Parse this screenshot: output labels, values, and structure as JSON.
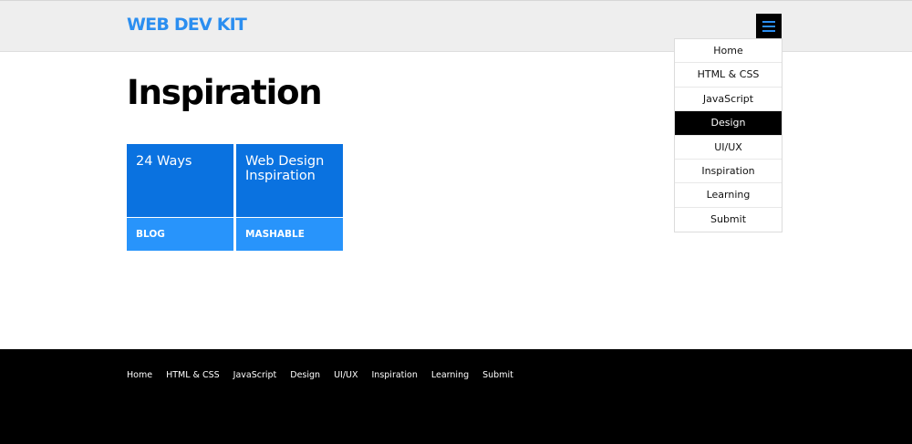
{
  "header": {
    "logo": "WEB DEV KIT",
    "menu_icon": "hamburger-menu-icon",
    "accent_color": "#2b8ef0"
  },
  "dropdown": {
    "items": [
      "Home",
      "HTML & CSS",
      "JavaScript",
      "Design",
      "UI/UX",
      "Inspiration",
      "Learning",
      "Submit"
    ],
    "active": "Design"
  },
  "main": {
    "title": "Inspiration",
    "cards": [
      {
        "name": "24 Ways",
        "source": "BLOG"
      },
      {
        "name": "Web Design Inspiration",
        "source": "MASHABLE"
      }
    ]
  },
  "footer": {
    "links": [
      "Home",
      "HTML & CSS",
      "JavaScript",
      "Design",
      "UI/UX",
      "Inspiration",
      "Learning",
      "Submit"
    ]
  },
  "colors": {
    "card_top": "#0a72e0",
    "card_bottom": "#2894fb",
    "footer_bg": "#000000"
  }
}
